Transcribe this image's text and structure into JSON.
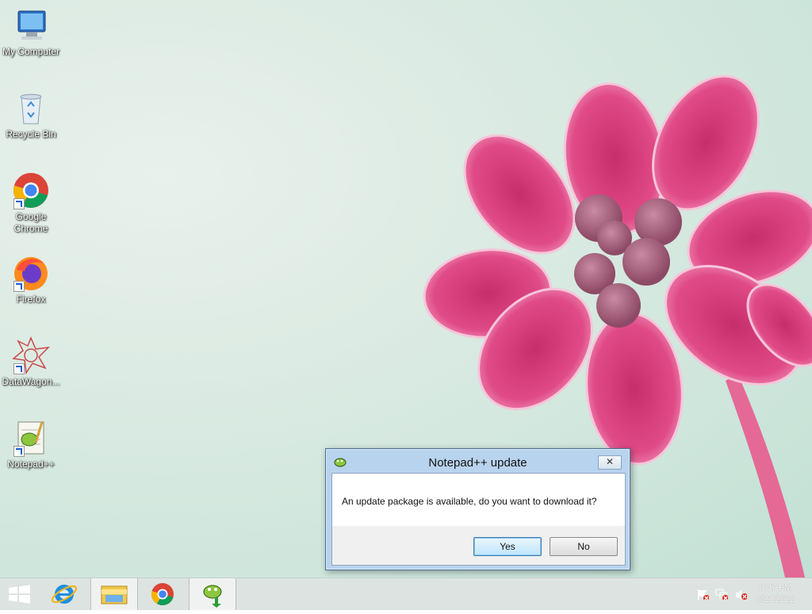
{
  "desktop": {
    "icons": [
      {
        "label": "My Computer"
      },
      {
        "label": "Recycle Bin"
      },
      {
        "label": "Google Chrome"
      },
      {
        "label": "Firefox"
      },
      {
        "label": "DataWagon..."
      },
      {
        "label": "Notepad++"
      }
    ]
  },
  "dialog": {
    "title": "Notepad++ update",
    "close_label": "✕",
    "message": "An update package is available, do you want to download it?",
    "yes_label": "Yes",
    "no_label": "No"
  },
  "taskbar": {
    "clock_time": "8:37 PM",
    "clock_date": "5/21/2022"
  },
  "colors": {
    "flower": "#e04a86",
    "dialog_frame": "#b8d3ee"
  }
}
